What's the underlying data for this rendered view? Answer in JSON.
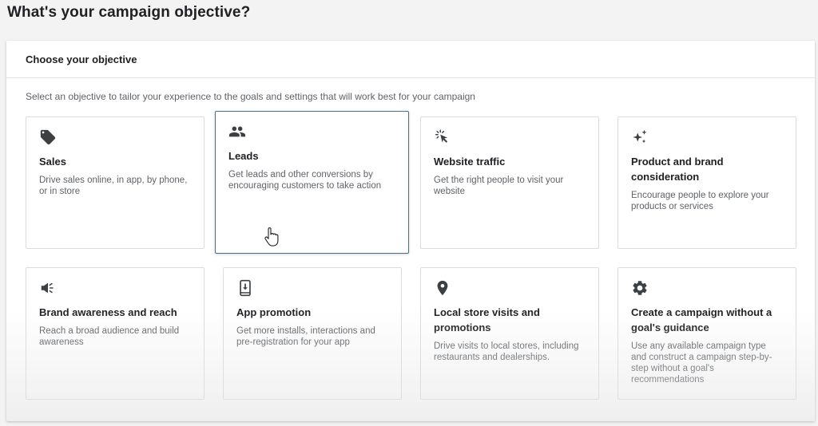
{
  "page": {
    "title": "What's your campaign objective?"
  },
  "panel": {
    "heading": "Choose your objective",
    "subtitle": "Select an objective to tailor your experience to the goals and settings that will work best for your campaign"
  },
  "objectives": [
    {
      "icon": "tag-icon",
      "title": "Sales",
      "description": "Drive sales online, in app, by phone, or in store",
      "selected": false
    },
    {
      "icon": "people-icon",
      "title": "Leads",
      "description": "Get leads and other conversions by encouraging customers to take action",
      "selected": true
    },
    {
      "icon": "click-cursor-icon",
      "title": "Website traffic",
      "description": "Get the right people to visit your website",
      "selected": false
    },
    {
      "icon": "sparkle-icon",
      "title": "Product and brand consideration",
      "description": "Encourage people to explore your products or services",
      "selected": false
    },
    {
      "icon": "megaphone-icon",
      "title": "Brand awareness and reach",
      "description": "Reach a broad audience and build awareness",
      "selected": false
    },
    {
      "icon": "phone-download-icon",
      "title": "App promotion",
      "description": "Get more installs, interactions and pre-registration for your app",
      "selected": false
    },
    {
      "icon": "location-pin-icon",
      "title": "Local store visits and promotions",
      "description": "Drive visits to local stores, including restaurants and dealerships.",
      "selected": false
    },
    {
      "icon": "gear-icon",
      "title": "Create a campaign without a goal's guidance",
      "description": "Use any available campaign type and construct a campaign step-by-step without a goal's recommendations",
      "selected": false
    }
  ],
  "colors": {
    "selected_border": "#4a6f95",
    "icon": "#3c4043",
    "description": "#5f6368"
  }
}
